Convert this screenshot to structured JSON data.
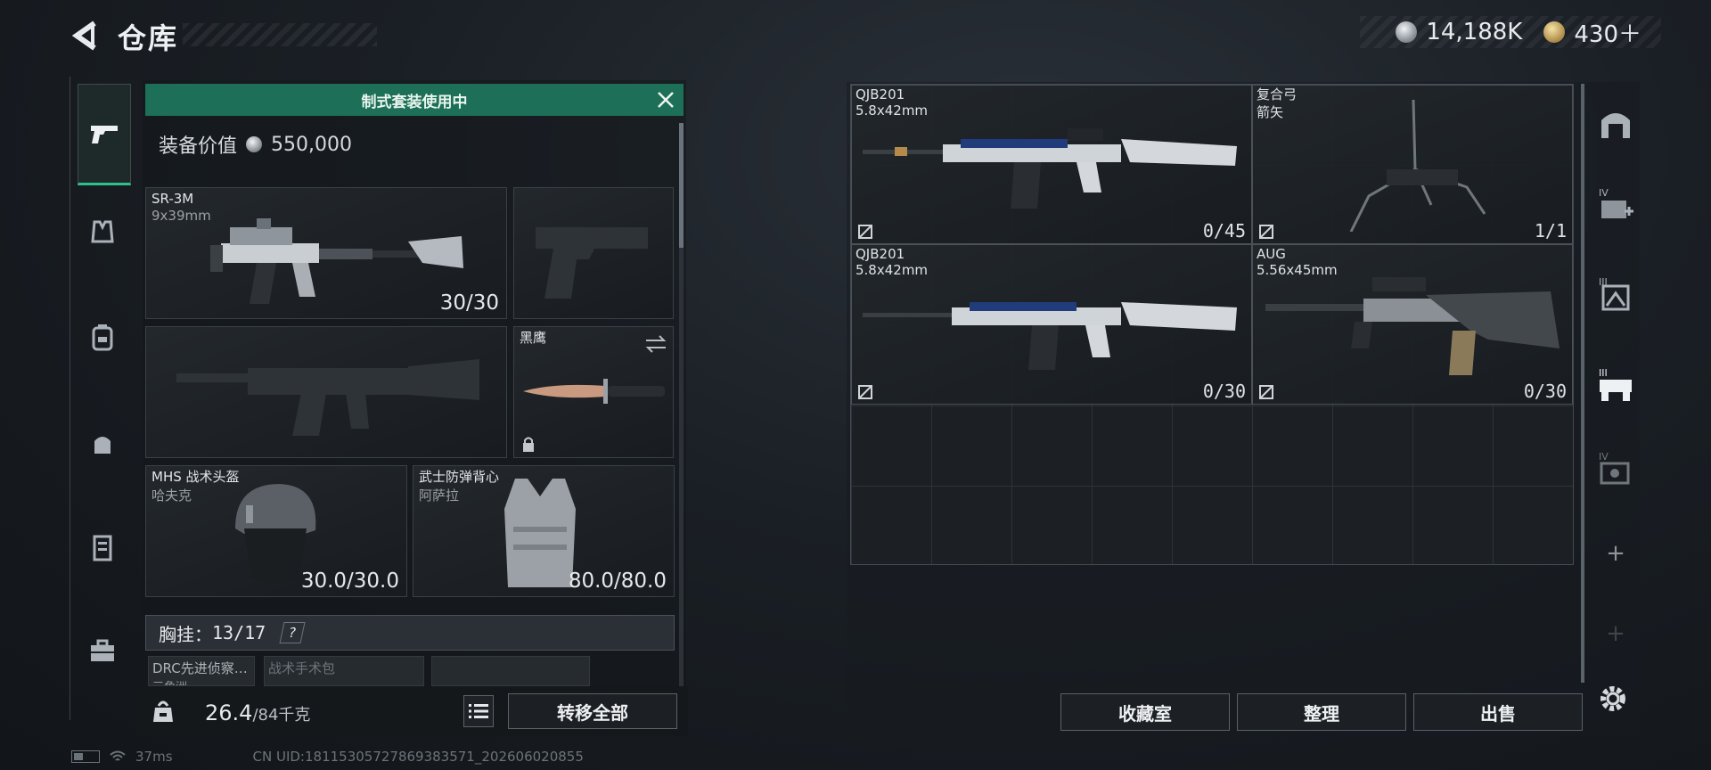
{
  "header": {
    "title": "仓库",
    "currency_a": "14,188K",
    "currency_b": "430＋"
  },
  "loadout": {
    "banner": "制式套装使用中",
    "value_label": "装备价值",
    "value": "550,000",
    "primary": {
      "name": "SR-3M",
      "caliber": "9x39mm",
      "count": "30/30"
    },
    "melee": {
      "name": "黑鹰"
    },
    "helmet": {
      "name": "MHS 战术头盔",
      "sub": "哈夫克",
      "durability": "30.0/30.0"
    },
    "armor": {
      "name": "武士防弹背心",
      "sub": "阿萨拉",
      "durability": "80.0/80.0"
    },
    "rig": {
      "label": "胸挂：",
      "count": "13/17",
      "help": "?"
    },
    "mini_items": [
      "DRC先进侦察…",
      "战术手术包"
    ],
    "mini_sub": "三角洲",
    "weight": "26.4",
    "weight_max": "/84千克",
    "transfer_all": "转移全部"
  },
  "stash": {
    "items": [
      {
        "name": "QJB201",
        "sub": "5.8x42mm",
        "count": "0/45"
      },
      {
        "name": "复合弓",
        "sub": "箭矢",
        "count": "1/1"
      },
      {
        "name": "QJB201",
        "sub": "5.8x42mm",
        "count": "0/30"
      },
      {
        "name": "AUG",
        "sub": "5.56x45mm",
        "count": "0/30"
      }
    ]
  },
  "actions": {
    "collection": "收藏室",
    "sort": "整理",
    "sell": "出售"
  },
  "right_rail": {
    "tab_iv": "IV",
    "tab_iii": "III",
    "tab_iii2": "III",
    "tab_iv2": "IV",
    "add": "+",
    "add2": "+"
  },
  "status": {
    "ping": "37ms",
    "uid": "CN UID:18115305727869383571_202606020855"
  }
}
